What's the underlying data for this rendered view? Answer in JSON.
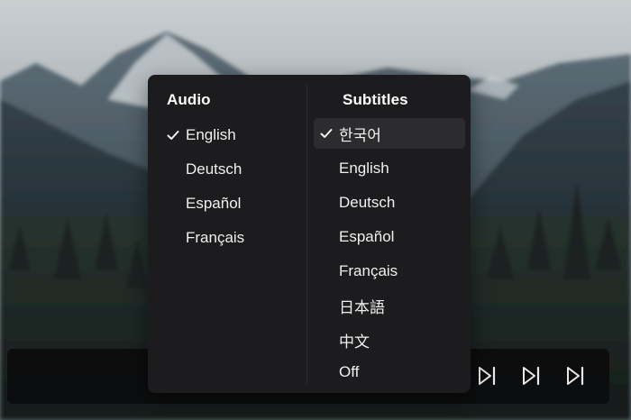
{
  "audio": {
    "heading": "Audio",
    "options": [
      {
        "label": "English",
        "selected": true
      },
      {
        "label": "Deutsch",
        "selected": false
      },
      {
        "label": "Español",
        "selected": false
      },
      {
        "label": "Français",
        "selected": false
      }
    ]
  },
  "subtitles": {
    "heading": "Subtitles",
    "options": [
      {
        "label": "한국어",
        "selected": true
      },
      {
        "label": "English",
        "selected": false
      },
      {
        "label": "Deutsch",
        "selected": false
      },
      {
        "label": "Español",
        "selected": false
      },
      {
        "label": "Français",
        "selected": false
      },
      {
        "label": "日本語",
        "selected": false
      },
      {
        "label": "中文",
        "selected": false
      },
      {
        "label": "Off",
        "selected": false
      }
    ]
  },
  "controls": {
    "icons": [
      "skip-next-icon",
      "skip-next-icon",
      "skip-next-icon"
    ]
  },
  "colors": {
    "menu_bg": "#1c1c1e",
    "selected_row_bg": "#2c2c2e",
    "text": "#f0f0f0"
  }
}
